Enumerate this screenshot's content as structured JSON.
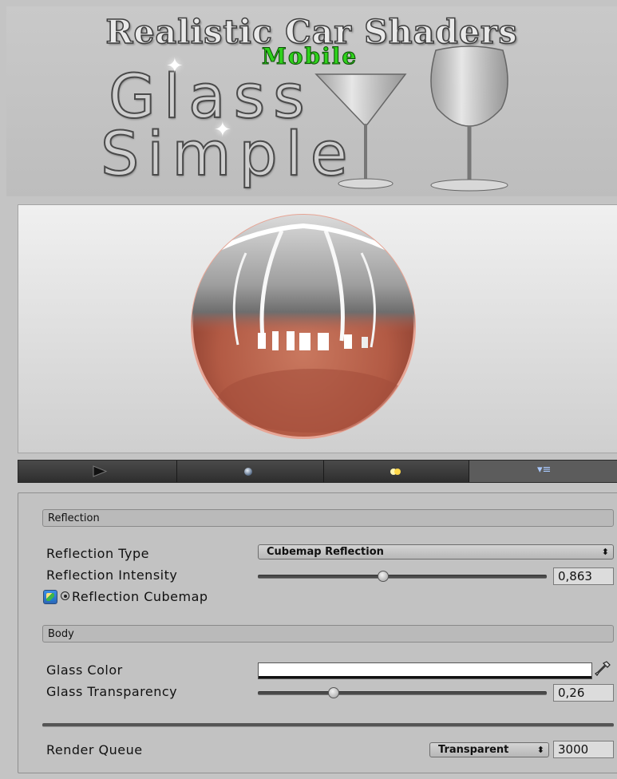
{
  "banner": {
    "title": "Realistic Car Shaders",
    "subtitle": "Mobile",
    "product_line1": "Glass",
    "product_line2": "Simple"
  },
  "preview_toolbar": {
    "buttons": [
      {
        "icon": "play-icon"
      },
      {
        "icon": "sphere-icon"
      },
      {
        "icon": "light-icon"
      }
    ],
    "menu_icon": "▾≡"
  },
  "inspector": {
    "sections": {
      "reflection": "Reflection",
      "body": "Body"
    },
    "reflection_type": {
      "label": "Reflection Type",
      "value": "Cubemap Reflection"
    },
    "reflection_intensity": {
      "label": "Reflection Intensity",
      "value": "0,863",
      "fraction": 0.863
    },
    "reflection_cubemap": {
      "label": "Reflection Cubemap"
    },
    "glass_color": {
      "label": "Glass Color",
      "color": "#ffffff"
    },
    "glass_transparency": {
      "label": "Glass Transparency",
      "value": "0,26",
      "fraction": 0.26
    },
    "render_queue": {
      "label": "Render Queue",
      "dropdown": "Transparent",
      "value": "3000"
    }
  },
  "colors": {
    "sphere_body": "#b8604a",
    "sphere_rim": "#e9a89b",
    "background": "#c4c4c4",
    "toolbar": "#3a3a3a"
  }
}
